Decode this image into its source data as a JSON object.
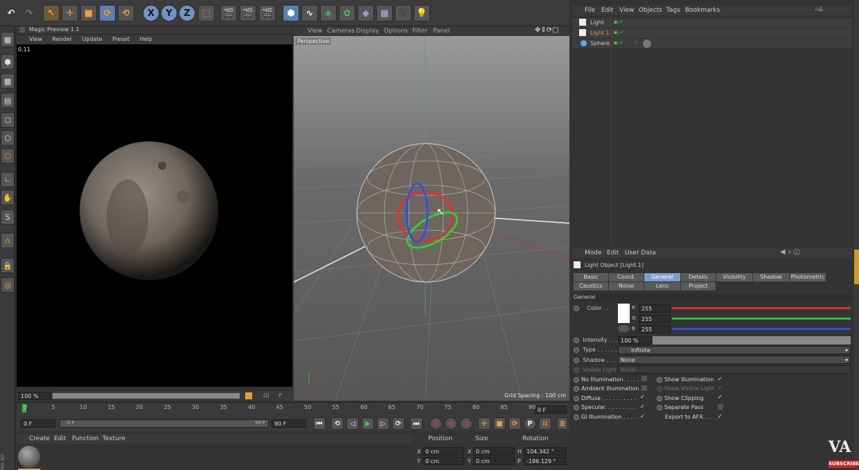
{
  "toolbar": {
    "xyz": [
      "X",
      "Y",
      "Z"
    ]
  },
  "left_tools": [
    "S"
  ],
  "magic_preview": {
    "title": "Magic Preview 1.1",
    "menu": [
      "View",
      "Render",
      "Update",
      "Preset",
      "Help"
    ],
    "timer": "0.11",
    "zoom": "100 %",
    "flags": [
      "GI",
      "P"
    ]
  },
  "viewport": {
    "menu": [
      "View",
      "Cameras",
      "Display",
      "Options",
      "Filter",
      "Panel"
    ],
    "label": "Perspective",
    "grid_spacing": "Grid Spacing : 100 cm"
  },
  "object_manager": {
    "menu": [
      "File",
      "Edit",
      "View",
      "Objects",
      "Tags",
      "Bookmarks"
    ],
    "objects": [
      {
        "name": "Light",
        "highlight": false
      },
      {
        "name": "Light.1",
        "highlight": true
      },
      {
        "name": "Sphere",
        "highlight": false
      }
    ]
  },
  "attributes": {
    "menu": [
      "Mode",
      "Edit",
      "User Data"
    ],
    "title": "Light Object [Light.1]",
    "tabs_row1": [
      "Basic",
      "Coord.",
      "General",
      "Details",
      "Visibility",
      "Shadow",
      "Photometric"
    ],
    "tabs_row2": [
      "Caustics",
      "Noise",
      "Lens",
      "Project"
    ],
    "active_tab": "General",
    "section": "General",
    "color_label": "Color . .",
    "rgb": [
      {
        "ch": "R",
        "val": "255",
        "color": "#e03030"
      },
      {
        "ch": "G",
        "val": "255",
        "color": "#30c030"
      },
      {
        "ch": "B",
        "val": "255",
        "color": "#3050e0"
      }
    ],
    "intensity_label": "Intensity . . .",
    "intensity": "100 %",
    "intensity_level": 1.0,
    "type_label": "Type . . . . . .",
    "type_value": "Infinite",
    "shadow_label": "Shadow . . .",
    "shadow_value": "None",
    "visible_light_label": "Visible Light",
    "visible_light_value": "None",
    "checks_left": [
      {
        "label": "No Illumination. . . . .",
        "checked": false
      },
      {
        "label": "Ambient Illumination",
        "checked": false
      },
      {
        "label": "Diffuse . . . . . . . . . .",
        "checked": true
      },
      {
        "label": "Specular. . . . . . . . .",
        "checked": true
      },
      {
        "label": "GI Illumination . . . . .",
        "checked": true
      }
    ],
    "checks_right": [
      {
        "label": "Show Illumination",
        "checked": true
      },
      {
        "label": "Show Visible Light",
        "checked": true
      },
      {
        "label": "Show Clipping",
        "checked": true
      },
      {
        "label": "Separate Pass",
        "checked": false
      },
      {
        "label": "Export to AFX. . . . .",
        "checked": true
      }
    ]
  },
  "timeline": {
    "ticks": [
      "0",
      "5",
      "10",
      "15",
      "20",
      "25",
      "30",
      "35",
      "40",
      "45",
      "50",
      "55",
      "60",
      "65",
      "70",
      "75",
      "80",
      "85",
      "90"
    ],
    "current_frame": "0 F",
    "start": "0 F",
    "slider_start": "0 F",
    "slider_end": "90 F",
    "end": "90 F"
  },
  "material_manager": {
    "menu": [
      "Create",
      "Edit",
      "Function",
      "Texture"
    ]
  },
  "coordinates": {
    "headers": [
      "Position",
      "Size",
      "Rotation"
    ],
    "rows": [
      {
        "axis": "X",
        "pos": "0 cm",
        "size_axis": "X",
        "size": "0 cm",
        "rot_axis": "H",
        "rot": "104.342 °"
      },
      {
        "axis": "Y",
        "pos": "0 cm",
        "size_axis": "Y",
        "size": "0 cm",
        "rot_axis": "P",
        "rot": "-186.129 °"
      }
    ]
  },
  "watermark": {
    "logo": "VA",
    "badge": "SUBSCRIBE",
    "side": "MA 4D"
  }
}
